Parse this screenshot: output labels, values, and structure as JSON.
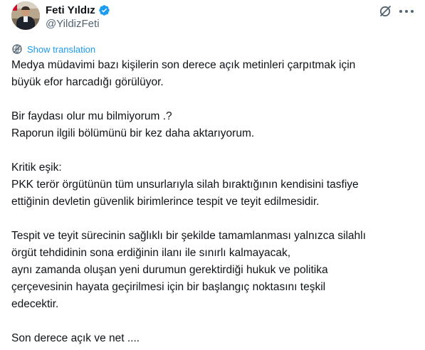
{
  "author": {
    "name": "Feti Yıldız",
    "handle": "@YildizFeti",
    "verified": true
  },
  "translate": {
    "label": "Show translation"
  },
  "icons": {
    "verified": "verified-badge-icon",
    "grok": "grok-icon",
    "more": "more-icon",
    "translate": "globe-translate-icon"
  },
  "colors": {
    "text": "#0f1419",
    "secondary": "#536471",
    "accent": "#1d9bf0"
  },
  "tweet": {
    "paragraphs": [
      [
        "Medya müdavimi bazı kişilerin son derece açık metinleri çarpıtmak için",
        "büyük efor harcadığı görülüyor."
      ],
      [
        "Bir faydası olur mu bilmiyorum .?",
        "Raporun ilgili bölümünü bir kez daha aktarıyorum."
      ],
      [
        "Kritik eşik:",
        "PKK terör örgütünün tüm unsurlarıyla silah bıraktığının kendisini tasfiye",
        "ettiğinin devletin güvenlik birimlerince tespit ve teyit edilmesidir."
      ],
      [
        "Tespit ve teyit sürecinin sağlıklı bir şekilde tamamlanması yalnızca silahlı",
        "örgüt tehdidinin sona erdiğinin ilanı ile sınırlı kalmayacak,",
        "aynı zamanda oluşan yeni durumun gerektirdiği hukuk ve politika",
        "çerçevesinin hayata geçirilmesi için bir başlangıç noktasını teşkil",
        "edecektir."
      ],
      [
        "Son derece açık ve net ...."
      ]
    ]
  }
}
